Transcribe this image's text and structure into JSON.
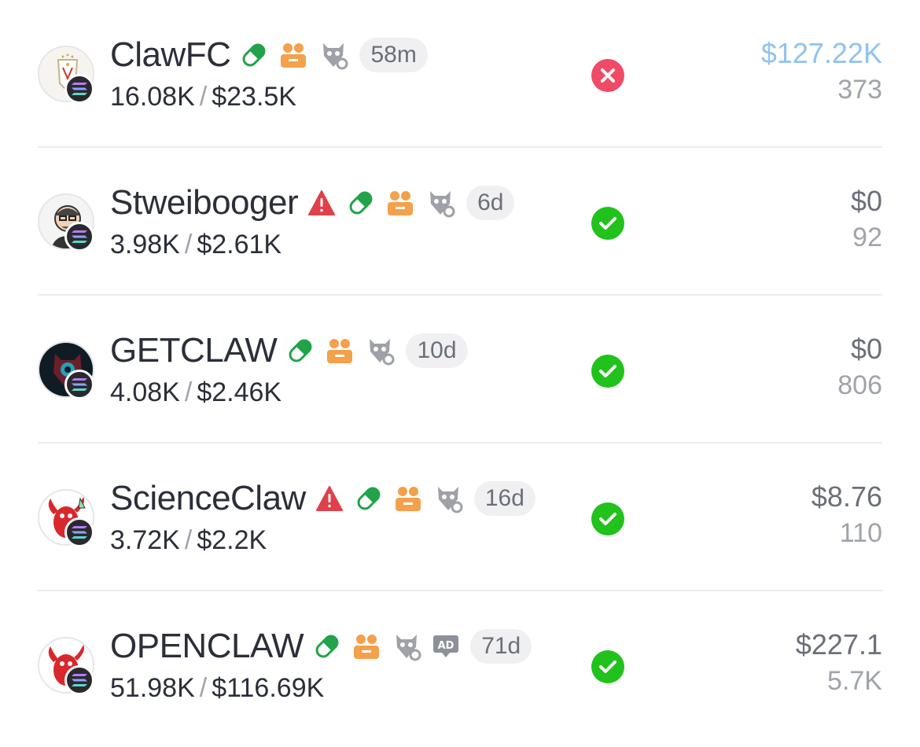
{
  "tokens": [
    {
      "name": "ClawFC",
      "age": "58m",
      "holders": "16.08K",
      "market_cap": "$23.5K",
      "value": "$127.22K",
      "count": "373",
      "status": "failed",
      "warning": false,
      "ad": false,
      "avatar": "clawfc-logo",
      "value_highlight": true
    },
    {
      "name": "Stweibooger",
      "age": "6d",
      "holders": "3.98K",
      "market_cap": "$2.61K",
      "value": "$0",
      "count": "92",
      "status": "success",
      "warning": true,
      "ad": false,
      "avatar": "cartoon-man",
      "value_highlight": false
    },
    {
      "name": "GETCLAW",
      "age": "10d",
      "holders": "4.08K",
      "market_cap": "$2.46K",
      "value": "$0",
      "count": "806",
      "status": "success",
      "warning": false,
      "ad": false,
      "avatar": "dark-emblem",
      "value_highlight": false
    },
    {
      "name": "ScienceClaw",
      "age": "16d",
      "holders": "3.72K",
      "market_cap": "$2.2K",
      "value": "$8.76",
      "count": "110",
      "status": "success",
      "warning": true,
      "ad": false,
      "avatar": "red-lobster",
      "value_highlight": false
    },
    {
      "name": "OPENCLAW",
      "age": "71d",
      "holders": "51.98K",
      "market_cap": "$116.69K",
      "value": "$227.1",
      "count": "5.7K",
      "status": "success",
      "warning": false,
      "ad": true,
      "ad_label": "AD",
      "avatar": "red-lobster",
      "value_highlight": false
    }
  ],
  "separator": "/",
  "icons": {
    "pill": "pill-icon",
    "holders": "holders-icon",
    "owl": "owl-icon",
    "warning": "warning-icon",
    "ad": "ad-icon",
    "success": "check-circle-icon",
    "failed": "x-circle-icon",
    "chain": "solana-icon"
  },
  "colors": {
    "pill_green": "#22a34a",
    "holders_orange": "#f5a04a",
    "owl_gray": "#8c9099",
    "warning_red": "#e0404a",
    "success_green": "#21c21b",
    "failed_red": "#f04a66",
    "value_highlight": "#8fc3f0"
  }
}
